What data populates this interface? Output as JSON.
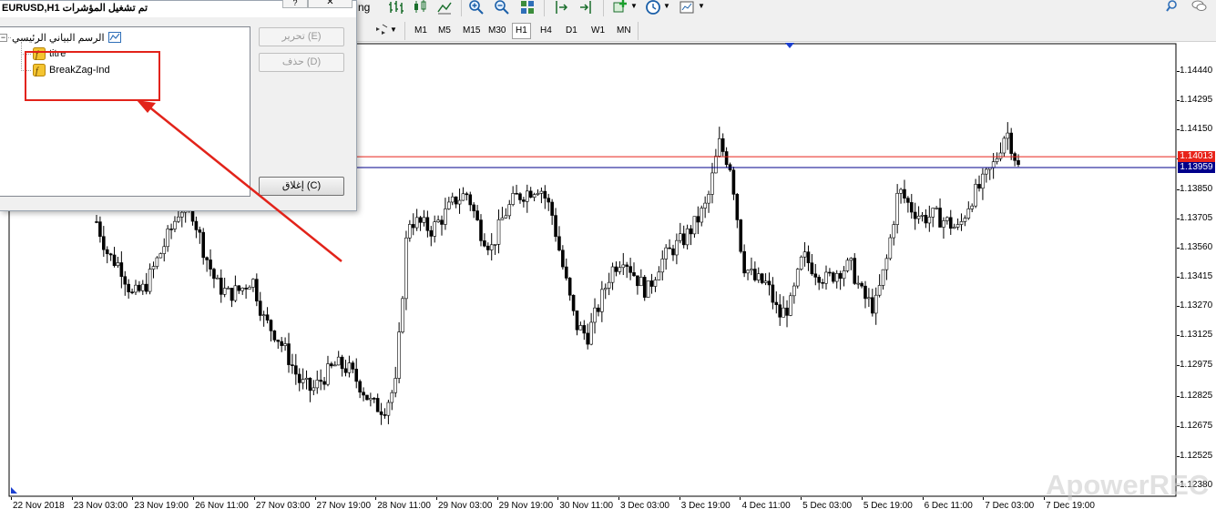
{
  "toolbar": {
    "left_partial_text": "ng",
    "timeframes": [
      "M1",
      "M5",
      "M15",
      "M30",
      "H1",
      "H4",
      "D1",
      "W1",
      "MN"
    ],
    "active_timeframe": "H1"
  },
  "dialog": {
    "title": "EURUSD,H1 تم تشغيل المؤشرات",
    "help_label": "?",
    "close_label": "✕",
    "tree": {
      "root_label": "الرسم البياني الرئيسي",
      "children": [
        {
          "label": "titre"
        },
        {
          "label": "BreakZag-Ind"
        }
      ]
    },
    "buttons": {
      "edit": "تحرير (E)",
      "delete": "حذف (D)",
      "close": "إغلاق (C)"
    }
  },
  "chart_data": {
    "type": "candlestick",
    "symbol": "EURUSD",
    "timeframe": "H1",
    "ylim": [
      1.1233,
      1.1457
    ],
    "y_ticks": [
      "1.14440",
      "1.14295",
      "1.14150",
      "1.14005",
      "1.13850",
      "1.13705",
      "1.13560",
      "1.13415",
      "1.13270",
      "1.13125",
      "1.12975",
      "1.12825",
      "1.12675",
      "1.12525",
      "1.12380"
    ],
    "x_ticks": [
      "22 Nov 2018",
      "23 Nov 03:00",
      "23 Nov 19:00",
      "26 Nov 11:00",
      "27 Nov 03:00",
      "27 Nov 19:00",
      "28 Nov 11:00",
      "29 Nov 03:00",
      "29 Nov 19:00",
      "30 Nov 11:00",
      "3 Dec 03:00",
      "3 Dec 19:00",
      "4 Dec 11:00",
      "5 Dec 03:00",
      "5 Dec 19:00",
      "6 Dec 11:00",
      "7 Dec 03:00",
      "7 Dec 19:00"
    ],
    "horizontal_lines": [
      {
        "price": "1.14013",
        "color": "#e8231a"
      },
      {
        "price": "1.13959",
        "color": "#00008b"
      }
    ],
    "bull_color": "#ffffff",
    "bear_color": "#000000",
    "close_path": [
      1.1369,
      1.1352,
      1.1347,
      1.1332,
      1.1336,
      1.1349,
      1.1362,
      1.1376,
      1.1374,
      1.1354,
      1.1338,
      1.1333,
      1.1335,
      1.1341,
      1.132,
      1.1313,
      1.1302,
      1.1289,
      1.1285,
      1.1292,
      1.1298,
      1.1296,
      1.1288,
      1.1278,
      1.1276,
      1.1288,
      1.137,
      1.1368,
      1.1365,
      1.1372,
      1.138,
      1.1383,
      1.1365,
      1.1356,
      1.1372,
      1.1381,
      1.1384,
      1.1387,
      1.1374,
      1.1345,
      1.1318,
      1.1312,
      1.1328,
      1.1345,
      1.1352,
      1.1342,
      1.1334,
      1.1348,
      1.1355,
      1.136,
      1.1368,
      1.1378,
      1.1408,
      1.1396,
      1.1348,
      1.134,
      1.1338,
      1.1322,
      1.1328,
      1.1352,
      1.1345,
      1.134,
      1.1345,
      1.1347,
      1.1332,
      1.1326,
      1.135,
      1.1385,
      1.1376,
      1.1371,
      1.1372,
      1.1369,
      1.1365,
      1.138,
      1.1388,
      1.1398,
      1.1415,
      1.1396
    ],
    "labels": {
      "watermark": "ApowerREC"
    }
  }
}
